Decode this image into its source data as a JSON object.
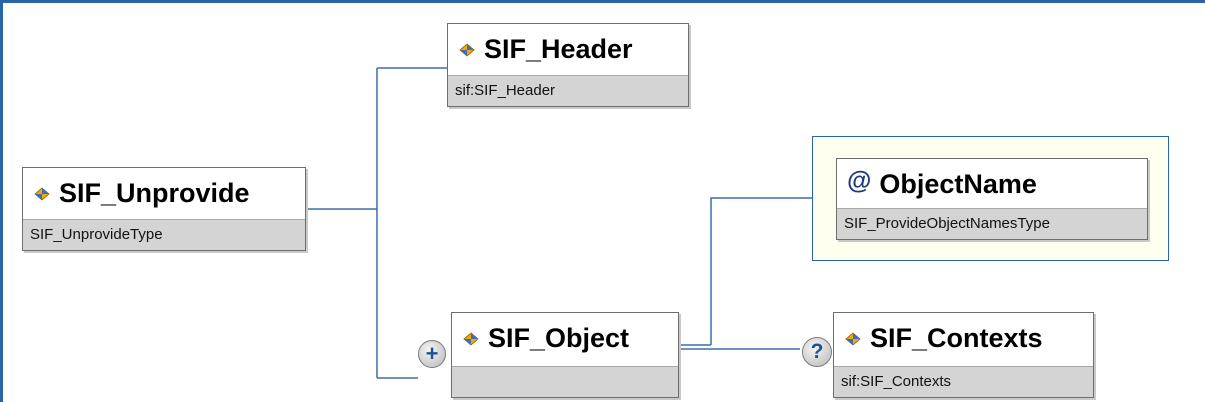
{
  "nodes": {
    "unprovide": {
      "name": "SIF_Unprovide",
      "type": "SIF_UnprovideType"
    },
    "header": {
      "name": "SIF_Header",
      "type": "sif:SIF_Header"
    },
    "object": {
      "name": "SIF_Object",
      "type": ""
    },
    "objectname": {
      "name": "ObjectName",
      "type": "SIF_ProvideObjectNamesType",
      "prefix": "@"
    },
    "contexts": {
      "name": "SIF_Contexts",
      "type": "sif:SIF_Contexts"
    }
  },
  "badges": {
    "expand": "+",
    "optional": "?"
  },
  "colors": {
    "frame": "#2a64a8",
    "connector": "#3f6fa8",
    "type_bar": "#d4d4d4",
    "attribute_panel": "#fffff0"
  },
  "icons": {
    "element": "element-diamond-icon"
  }
}
